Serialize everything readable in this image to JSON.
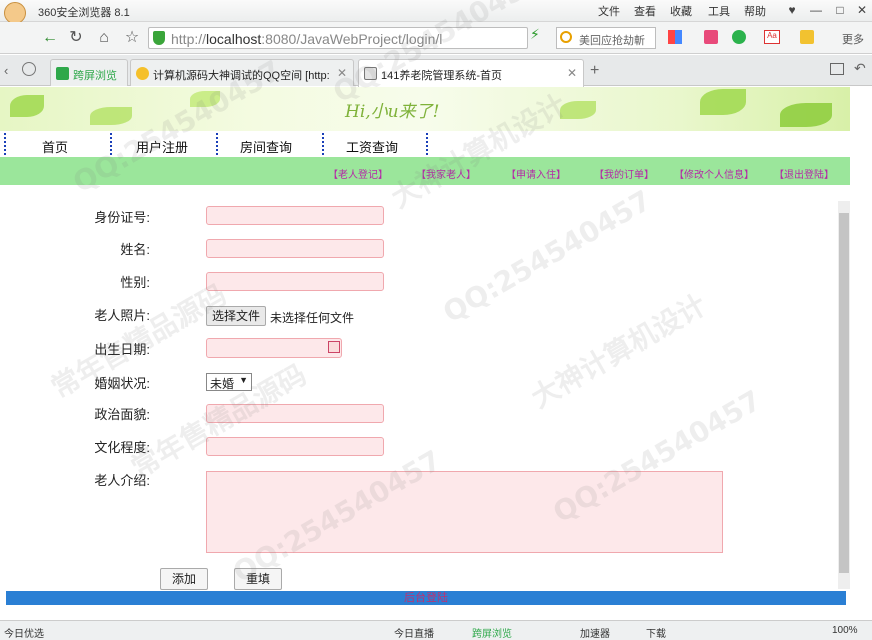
{
  "browser": {
    "app_title": "360安全浏览器 8.1",
    "menu": [
      "文件",
      "查看",
      "收藏",
      "工具",
      "帮助"
    ],
    "url_host": "http://",
    "url_main": "localhost",
    "url_rest": ":8080/JavaWebProject/login/l",
    "search_text": "美回应抢劫斬",
    "toolbar_more": "更多",
    "tabs": [
      {
        "label": "跨屏浏览"
      },
      {
        "label": "计算机源码大神调试的QQ空间 [http:"
      },
      {
        "label": "141养老院管理系统-首页"
      }
    ]
  },
  "banner": {
    "greeting": "Hi,小u来了!"
  },
  "nav": [
    "首页",
    "用户注册",
    "房间查询",
    "工资查询"
  ],
  "subnav": [
    "【老人登记】",
    "【我家老人】",
    "【申请入住】",
    "【我的订单】",
    "【修改个人信息】",
    "【退出登陆】"
  ],
  "form": {
    "id_label": "身份证号:",
    "name_label": "姓名:",
    "gender_label": "性别:",
    "photo_label": "老人照片:",
    "file_button": "选择文件",
    "file_status": "未选择任何文件",
    "birth_label": "出生日期:",
    "marital_label": "婚姻状况:",
    "marital_value": "未婚",
    "political_label": "政治面貌:",
    "education_label": "文化程度:",
    "intro_label": "老人介绍:",
    "add_button": "添加",
    "reset_button": "重填"
  },
  "footer": {
    "text": "后台登陆"
  },
  "statusbar": {
    "left": "今日优选",
    "live": "今日直播",
    "screen": "跨屏浏览",
    "accel": "加速器",
    "download": "下载",
    "zoom": "100%"
  },
  "watermark": {
    "qq": "QQ:254540457",
    "brand1": "常年售精品源码",
    "brand2": "大神计算机设计"
  }
}
